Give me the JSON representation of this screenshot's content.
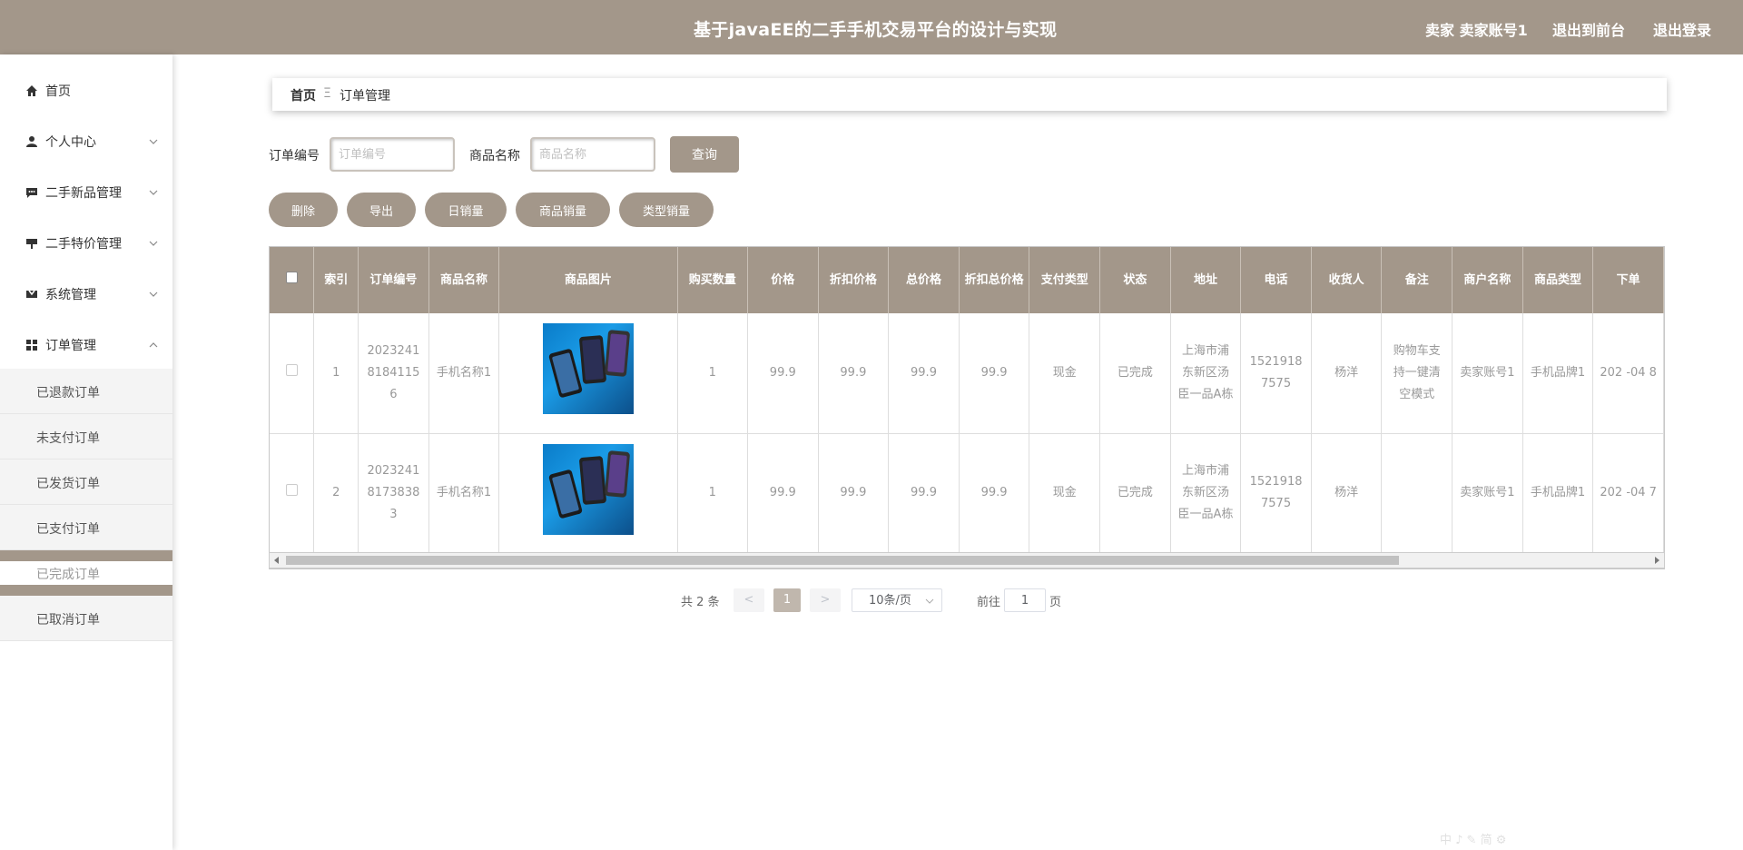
{
  "header": {
    "title": "基于javaEE的二手手机交易平台的设计与实现",
    "user": "卖家 卖家账号1",
    "link_front": "退出到前台",
    "link_logout": "退出登录",
    "bg_color": "#a3978a"
  },
  "sidebar": {
    "items": [
      {
        "label": "首页",
        "icon": "home-icon"
      },
      {
        "label": "个人中心",
        "icon": "user-icon"
      },
      {
        "label": "二手新品管理",
        "icon": "chat-icon"
      },
      {
        "label": "二手特价管理",
        "icon": "tag-icon"
      },
      {
        "label": "系统管理",
        "icon": "cog-icon"
      },
      {
        "label": "订单管理",
        "icon": "grid-icon"
      }
    ],
    "sub_items": [
      "已退款订单",
      "未支付订单",
      "已发货订单",
      "已支付订单",
      "已完成订单",
      "已取消订单"
    ]
  },
  "breadcrumb": {
    "home": "首页",
    "sep": "Ξ",
    "current": "订单管理"
  },
  "search": {
    "order_label": "订单编号",
    "order_placeholder": "订单编号",
    "product_label": "商品名称",
    "product_placeholder": "商品名称",
    "query_button": "查询"
  },
  "actions": {
    "delete": "删除",
    "export": "导出",
    "daily_sales": "日销量",
    "product_sales": "商品销量",
    "type_sales": "类型销量"
  },
  "table": {
    "headers": [
      "索引",
      "订单编号",
      "商品名称",
      "商品图片",
      "购买数量",
      "价格",
      "折扣价格",
      "总价格",
      "折扣总价格",
      "支付类型",
      "状态",
      "地址",
      "电话",
      "收货人",
      "备注",
      "商户名称",
      "商品类型",
      "下单"
    ],
    "rows": [
      {
        "index": "1",
        "order_no": "20232418184115 6",
        "name": "手机名称1",
        "qty": "1",
        "price": "99.9",
        "discount_price": "99.9",
        "total": "99.9",
        "discount_total": "99.9",
        "pay_type": "现金",
        "status": "已完成",
        "address": "上海市浦东新区汤臣一品A栋",
        "phone": "15219187575",
        "receiver": "杨洋",
        "remark": "购物车支持一键清空模式",
        "merchant": "卖家账号1",
        "type": "手机品牌1",
        "time": "202 -04 8"
      },
      {
        "index": "2",
        "order_no": "20232418173838 3",
        "name": "手机名称1",
        "qty": "1",
        "price": "99.9",
        "discount_price": "99.9",
        "total": "99.9",
        "discount_total": "99.9",
        "pay_type": "现金",
        "status": "已完成",
        "address": "上海市浦东新区汤臣一品A栋",
        "phone": "15219187575",
        "receiver": "杨洋",
        "remark": "",
        "merchant": "卖家账号1",
        "type": "手机品牌1",
        "time": "202 -04 7"
      }
    ]
  },
  "pagination": {
    "total": "共 2 条",
    "prev": "<",
    "page": "1",
    "next": ">",
    "size": "10条/页",
    "goto_label": "前往",
    "goto_value": "1",
    "page_suffix": "页"
  },
  "watermark": "中 ♪ ✎ 简 ⚙"
}
